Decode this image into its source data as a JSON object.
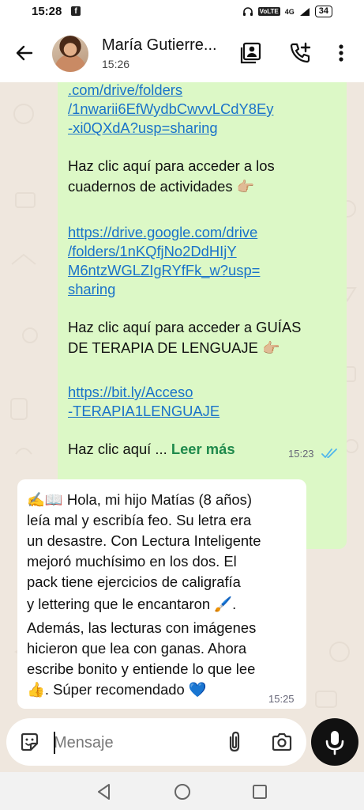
{
  "status_bar": {
    "time": "15:28",
    "volte": "VoLTE",
    "network": "4G",
    "battery": "34"
  },
  "header": {
    "contact_name": "María Gutierre...",
    "subtitle": "15:26"
  },
  "messages": {
    "outgoing": {
      "lines": [
        {
          "text": ".com/drive/folders",
          "link": true
        },
        {
          "text": "/1nwarii6EfWydbCwvvLCdY8Ey",
          "link": true
        },
        {
          "text": "-xi0QXdA?usp=sharing",
          "link": true
        },
        {
          "text": "Haz clic aquí para acceder a los",
          "link": false
        },
        {
          "text": "cuadernos de actividades",
          "link": false
        },
        {
          "text": "https://drive.google.com/drive",
          "link": true
        },
        {
          "text": "/folders/1nKQfjNo2DdHIjY",
          "link": true
        },
        {
          "text": "M6ntzWGLZIgRYfFk_w?usp=",
          "link": true
        },
        {
          "text": "sharing",
          "link": true
        },
        {
          "text": "Haz clic aquí para acceder a GUÍAS",
          "link": false
        },
        {
          "text": "DE TERAPIA DE LENGUAJE",
          "link": false
        },
        {
          "text": "https://bit.ly/Acceso",
          "link": true
        },
        {
          "text": "-TERAPIA1LENGUAJE",
          "link": true
        }
      ],
      "truncated_text": "Haz clic aquí ...",
      "read_more": "Leer más",
      "time": "15:23",
      "hand_emoji": "👉🏼"
    },
    "incoming": {
      "lines": [
        "✍️📖 Hola, mi hijo Matías (8 años)",
        "leía mal y escribía feo. Su letra era",
        "un desastre. Con Lectura Inteligente",
        "mejoró muchísimo en los dos. El",
        "pack tiene ejercicios de caligrafía",
        "y lettering que le encantaron 🖌️.",
        "Además, las lecturas con imágenes",
        "hicieron que lea con ganas. Ahora",
        "escribe bonito y entiende lo que lee",
        "👍. Súper recomendado 💙"
      ],
      "time": "15:25"
    }
  },
  "composer": {
    "placeholder": "Mensaje"
  },
  "icons": {
    "back": "arrow-left-icon",
    "contact_card": "contact-card-icon",
    "add_call": "add-call-icon",
    "menu": "more-vertical-icon",
    "sticker": "sticker-icon",
    "attach": "paperclip-icon",
    "camera": "camera-icon",
    "mic": "microphone-icon"
  },
  "colors": {
    "outgoing_bubble": "#dcf8c6",
    "link": "#1a73c9",
    "read_more": "#1f8a4c",
    "read_ticks": "#4fb6ec",
    "chat_background": "#efe7de"
  }
}
